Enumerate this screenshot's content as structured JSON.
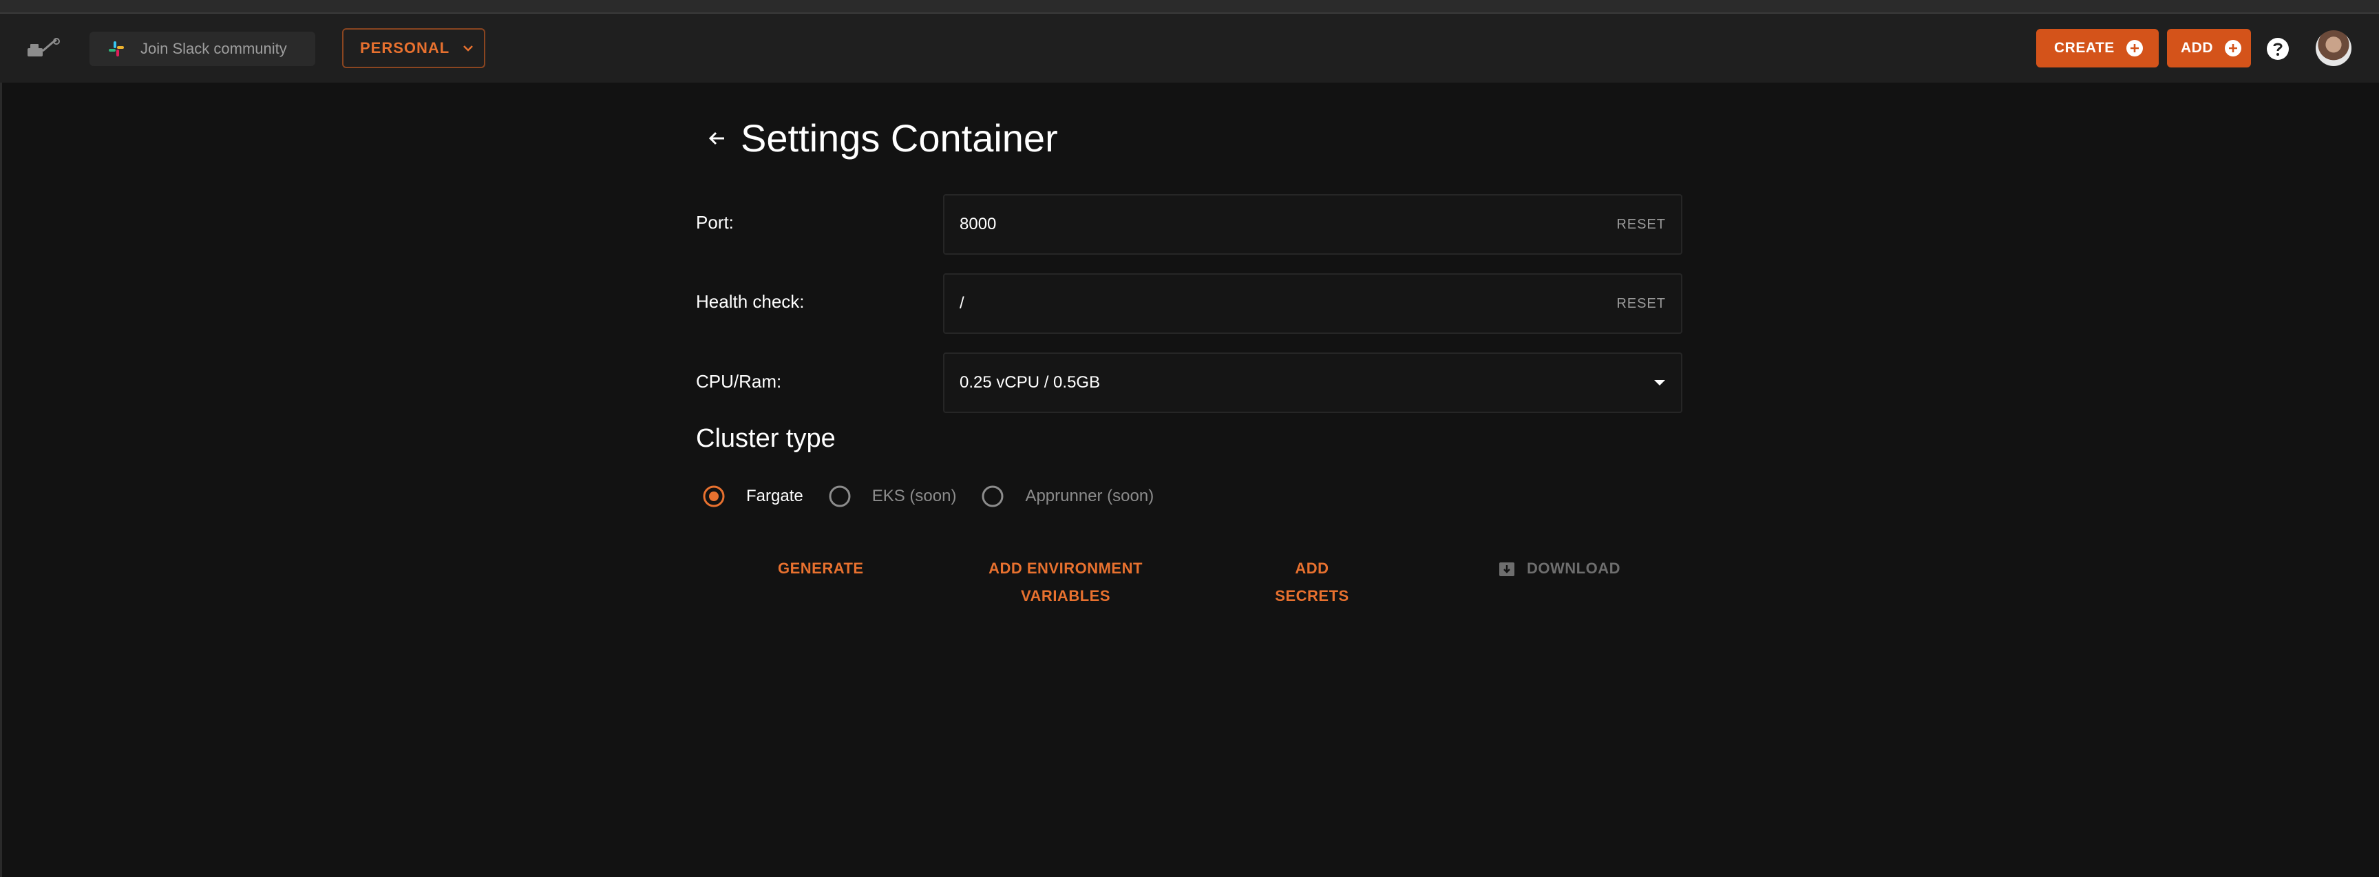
{
  "header": {
    "slack_label": "Join Slack community",
    "workspace_label": "PERSONAL",
    "create_label": "CREATE",
    "add_label": "ADD"
  },
  "main": {
    "title": "Settings Container",
    "fields": [
      {
        "label": "Port:",
        "value": "8000",
        "action": "RESET"
      },
      {
        "label": "Health check:",
        "value": "/",
        "action": "RESET"
      },
      {
        "label": "CPU/Ram:",
        "value": "0.25 vCPU / 0.5GB"
      }
    ],
    "cluster_title": "Cluster type",
    "cluster_options": [
      {
        "label": "Fargate",
        "selected": true,
        "enabled": true
      },
      {
        "label": "EKS (soon)",
        "selected": false,
        "enabled": false
      },
      {
        "label": "Apprunner (soon)",
        "selected": false,
        "enabled": false
      }
    ],
    "actions": {
      "generate": "GENERATE",
      "env_line1": "ADD ENVIRONMENT",
      "env_line2": "VARIABLES",
      "secrets": "ADD SECRETS",
      "download": "DOWNLOAD"
    }
  },
  "colors": {
    "accent": "#e8712f",
    "button_bg": "#d4531a",
    "background": "#121212",
    "header_bg": "#1f1f1f"
  },
  "icons": [
    "logo-icon",
    "slack-icon",
    "chevron-down-icon",
    "plus-circle-icon",
    "help-icon",
    "avatar",
    "back-arrow-icon",
    "dropdown-arrow-icon",
    "radio-icon",
    "download-icon"
  ]
}
